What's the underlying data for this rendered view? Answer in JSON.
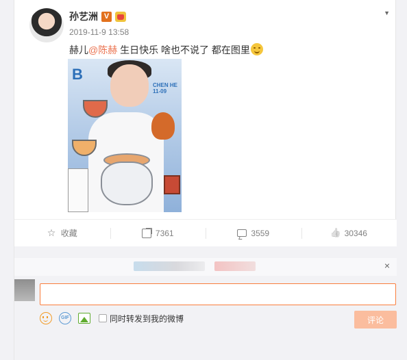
{
  "post": {
    "author": "孙艺洲",
    "verified_badge": "V",
    "timestamp": "2019-11-9 13:58",
    "text_prefix": "赫儿",
    "mention": "@陈赫",
    "text_suffix": " 生日快乐  啥也不说了 都在图里",
    "image_text": "B",
    "image_label": "CHEN HE 11-09"
  },
  "actions": {
    "favorite_label": "收藏",
    "share_count": "7361",
    "comment_count": "3559",
    "like_count": "30346"
  },
  "comment_box": {
    "placeholder": "",
    "repost_label": "同时转发到我的微博",
    "submit_label": "评论",
    "close_label": "×"
  },
  "icons": {
    "favorite": "star-icon",
    "share": "share-icon",
    "comment": "comment-icon",
    "like": "thumbs-up-icon",
    "emoji": "smile-icon",
    "gif": "gif-icon",
    "picture": "picture-icon"
  },
  "colors": {
    "accent": "#eb7350",
    "input_border": "#fa7d3c",
    "submit_disabled": "#fbbd9e",
    "verified": "#e2711e"
  }
}
